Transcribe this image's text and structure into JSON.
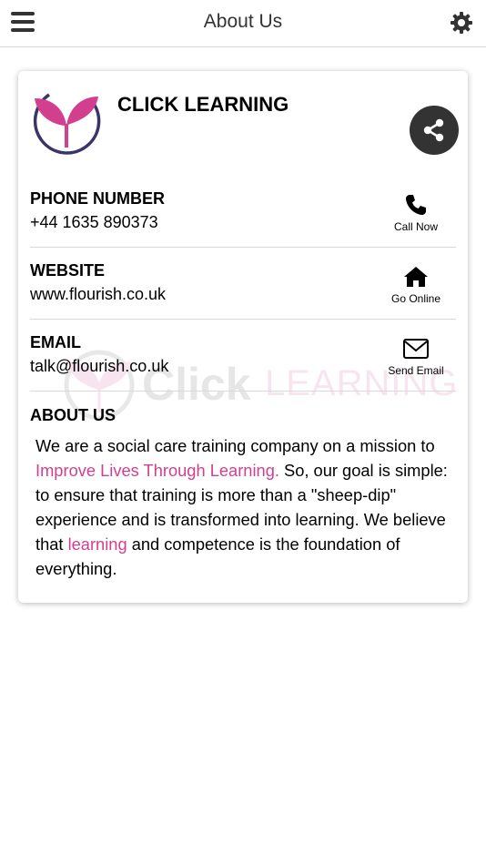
{
  "header": {
    "title": "About Us",
    "menu_icon": "hamburger-menu-icon",
    "settings_icon": "gear-icon"
  },
  "company": {
    "name": "CLICK LEARNING",
    "logo_icon": "sprout-logo",
    "share_icon": "share-icon"
  },
  "contacts": [
    {
      "label": "PHONE NUMBER",
      "value": "+44 1635 890373",
      "action_label": "Call Now",
      "icon": "phone-icon"
    },
    {
      "label": "WEBSITE",
      "value": "www.flourish.co.uk",
      "action_label": "Go Online",
      "icon": "home-icon"
    },
    {
      "label": "EMAIL",
      "value": "talk@flourish.co.uk",
      "action_label": "Send Email",
      "icon": "envelope-icon"
    }
  ],
  "watermark": {
    "text_click": "Click",
    "text_learning": "LEARNING"
  },
  "about": {
    "title": "ABOUT US",
    "text_1": "We are a social care training company on a mission to ",
    "link_1": "Improve Lives Through Learning.",
    "text_2": " So, our goal is simple: to ensure that training is more than a \"sheep-dip\" experience and is transformed into learning. We believe that ",
    "link_2": "learning",
    "text_3": " and competence is the foundation of everything."
  },
  "colors": {
    "accent": "#d23f8f",
    "logo_ring": "#3a3468",
    "share_bg": "#333333"
  }
}
